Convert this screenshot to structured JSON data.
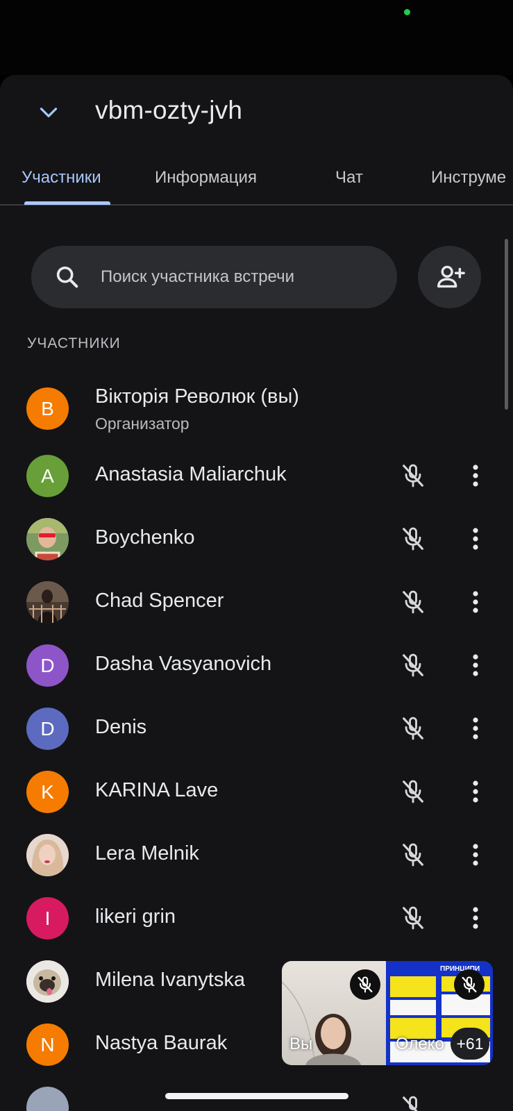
{
  "meeting": {
    "code": "vbm-ozty-jvh"
  },
  "tabs": [
    {
      "label": "Участники",
      "active": true
    },
    {
      "label": "Информация",
      "active": false
    },
    {
      "label": "Чат",
      "active": false
    },
    {
      "label": "Инструме",
      "active": false
    }
  ],
  "search": {
    "placeholder": "Поиск участника встречи",
    "icon": "search-icon"
  },
  "add_person_icon": "person-add-icon",
  "section_label": "УЧАСТНИКИ",
  "participants": [
    {
      "initial": "В",
      "name": "Вікторія Революк (вы)",
      "role": "Организатор",
      "avatar_color": "#f57c00",
      "photo": false
    },
    {
      "initial": "A",
      "name": "Anastasia Maliarchuk",
      "avatar_color": "#689f38",
      "photo": false,
      "muted": true
    },
    {
      "initial": "",
      "name": "Boychenko",
      "avatar_color": "#6d8a5a",
      "photo": true,
      "muted": true
    },
    {
      "initial": "",
      "name": "Chad Spencer",
      "avatar_color": "#3a2a22",
      "photo": true,
      "muted": true
    },
    {
      "initial": "D",
      "name": "Dasha Vasyanovich",
      "avatar_color": "#8e55c9",
      "photo": false,
      "muted": true
    },
    {
      "initial": "D",
      "name": "Denis",
      "avatar_color": "#5c6bc0",
      "photo": false,
      "muted": true
    },
    {
      "initial": "K",
      "name": "KARINA Lave",
      "avatar_color": "#f57c00",
      "photo": false,
      "muted": true
    },
    {
      "initial": "",
      "name": "Lera Melnik",
      "avatar_color": "#c9a28e",
      "photo": true,
      "muted": true
    },
    {
      "initial": "I",
      "name": "likeri grin",
      "avatar_color": "#d81b60",
      "photo": false,
      "muted": true
    },
    {
      "initial": "",
      "name": "Milena Ivanytska",
      "avatar_color": "#d8d3cc",
      "photo": true
    },
    {
      "initial": "N",
      "name": "Nastya Baurak",
      "avatar_color": "#f57c00",
      "photo": false
    }
  ],
  "pip": {
    "self_label": "Вы",
    "other_label": "Олеко",
    "others_count": "+61",
    "slide_title": "ПРИНЦИПИ",
    "colors": {
      "slide_bg": "#1432c8",
      "slide_yellow": "#f5e31b"
    }
  },
  "colors": {
    "accent": "#a8c7fa",
    "background": "#141416",
    "surface": "#2b2c2f"
  }
}
